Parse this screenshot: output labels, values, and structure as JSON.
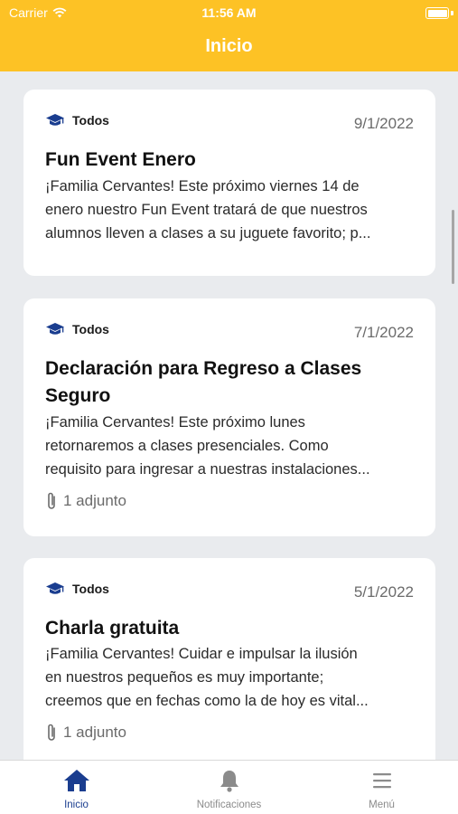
{
  "status": {
    "carrier": "Carrier",
    "time": "11:56 AM"
  },
  "header": {
    "title": "Inicio"
  },
  "colors": {
    "accent": "#fdc225",
    "brand": "#1a3d8f"
  },
  "posts": [
    {
      "audience": "Todos",
      "date": "9/1/2022",
      "title": "Fun Event Enero",
      "body": [
        "¡Familia Cervantes! Este próximo viernes 14 de",
        "enero nuestro Fun Event tratará de que nuestros",
        "alumnos lleven a clases a su juguete favorito; p..."
      ],
      "attachment": ""
    },
    {
      "audience": "Todos",
      "date": "7/1/2022",
      "title": [
        "Declaración para Regreso a Clases",
        "Seguro"
      ],
      "body": [
        "¡Familia Cervantes! Este próximo lunes",
        "retornaremos a clases presenciales. Como",
        "requisito para ingresar a nuestras instalaciones..."
      ],
      "attachment": "1 adjunto"
    },
    {
      "audience": "Todos",
      "date": "5/1/2022",
      "title": "Charla gratuita",
      "body": [
        "¡Familia Cervantes! Cuidar e impulsar la ilusión",
        "en nuestros pequeños es muy importante;",
        "creemos que en fechas como la de hoy es vital..."
      ],
      "attachment": "1 adjunto"
    }
  ],
  "tabs": [
    {
      "label": "Inicio",
      "icon": "home-icon",
      "active": true
    },
    {
      "label": "Notificaciones",
      "icon": "bell-icon",
      "active": false
    },
    {
      "label": "Menú",
      "icon": "menu-icon",
      "active": false
    }
  ]
}
